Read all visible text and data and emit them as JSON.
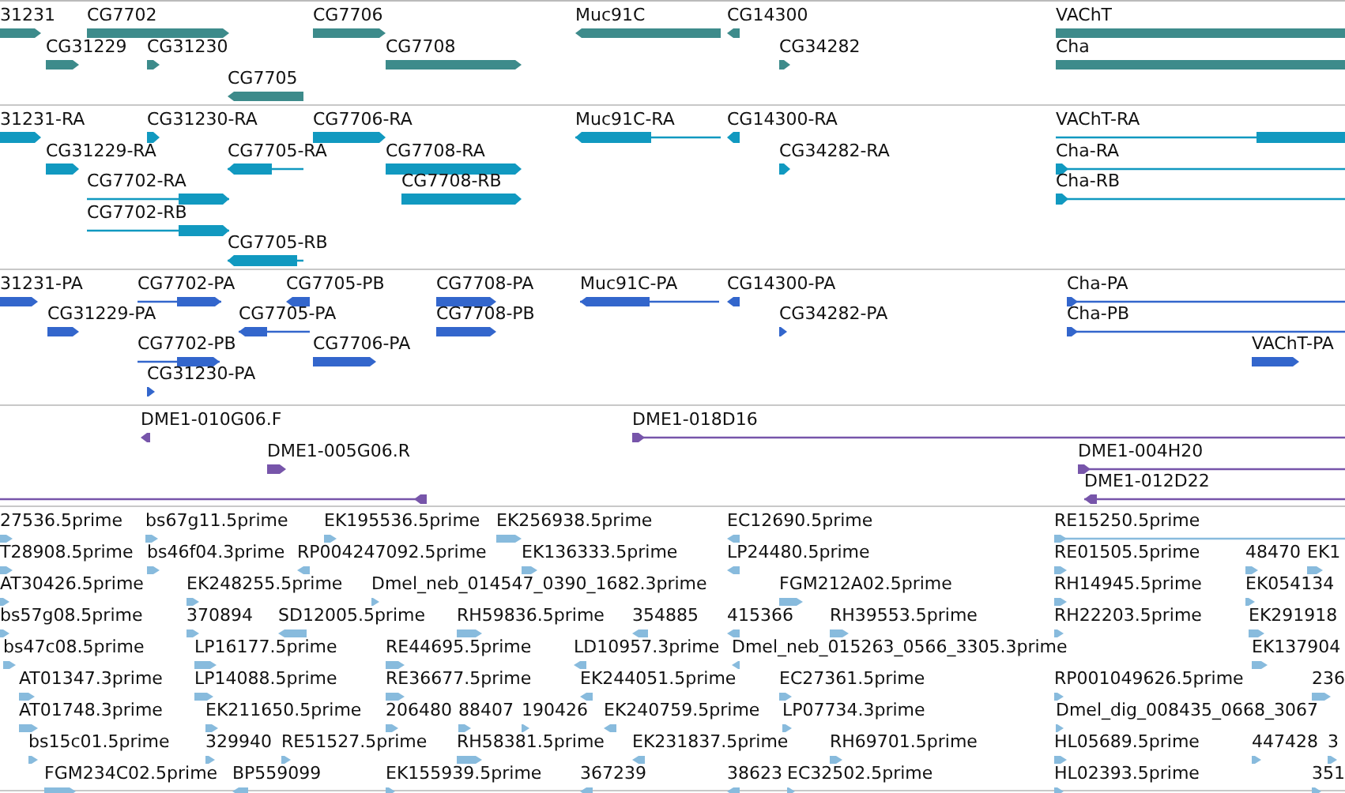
{
  "tracks": [
    {
      "kind": "gene",
      "features": [
        {
          "label": "31231",
          "reverse": false
        },
        {
          "label": "CG7702",
          "reverse": false
        },
        {
          "label": "CG7706",
          "reverse": false
        },
        {
          "label": "Muc91C",
          "reverse": true
        },
        {
          "label": "CG14300",
          "reverse": true
        },
        {
          "label": "VAChT",
          "reverse": false
        },
        {
          "label": "CG31229",
          "reverse": false
        },
        {
          "label": "CG31230",
          "reverse": false
        },
        {
          "label": "CG7708",
          "reverse": false
        },
        {
          "label": "CG34282",
          "reverse": false
        },
        {
          "label": "Cha",
          "reverse": false
        },
        {
          "label": "CG7705",
          "reverse": true
        }
      ]
    },
    {
      "kind": "transcript",
      "features": [
        {
          "label": "31231-RA",
          "reverse": false
        },
        {
          "label": "CG31230-RA",
          "reverse": false
        },
        {
          "label": "CG7706-RA",
          "reverse": false
        },
        {
          "label": "Muc91C-RA",
          "reverse": true
        },
        {
          "label": "CG14300-RA",
          "reverse": true
        },
        {
          "label": "VAChT-RA",
          "reverse": false
        },
        {
          "label": "CG31229-RA",
          "reverse": false
        },
        {
          "label": "CG7705-RA",
          "reverse": true
        },
        {
          "label": "CG7708-RA",
          "reverse": false
        },
        {
          "label": "CG34282-RA",
          "reverse": false
        },
        {
          "label": "Cha-RA",
          "reverse": false
        },
        {
          "label": "CG7702-RA",
          "reverse": false
        },
        {
          "label": "CG7708-RB",
          "reverse": false
        },
        {
          "label": "Cha-RB",
          "reverse": false
        },
        {
          "label": "CG7702-RB",
          "reverse": false
        },
        {
          "label": "CG7705-RB",
          "reverse": true
        }
      ]
    },
    {
      "kind": "protein",
      "features": [
        {
          "label": "31231-PA",
          "reverse": false
        },
        {
          "label": "CG7702-PA",
          "reverse": false
        },
        {
          "label": "CG7705-PB",
          "reverse": true
        },
        {
          "label": "CG7708-PA",
          "reverse": false
        },
        {
          "label": "Muc91C-PA",
          "reverse": true
        },
        {
          "label": "CG14300-PA",
          "reverse": true
        },
        {
          "label": "Cha-PA",
          "reverse": false
        },
        {
          "label": "CG31229-PA",
          "reverse": false
        },
        {
          "label": "CG7705-PA",
          "reverse": true
        },
        {
          "label": "CG7708-PB",
          "reverse": false
        },
        {
          "label": "CG34282-PA",
          "reverse": false
        },
        {
          "label": "Cha-PB",
          "reverse": false
        },
        {
          "label": "CG7702-PB",
          "reverse": false
        },
        {
          "label": "CG7706-PA",
          "reverse": false
        },
        {
          "label": "VAChT-PA",
          "reverse": false
        },
        {
          "label": "CG31230-PA",
          "reverse": false
        }
      ]
    },
    {
      "kind": "clone",
      "features": [
        {
          "label": "DME1-010G06.F",
          "reverse": true
        },
        {
          "label": "DME1-018D16",
          "reverse": false
        },
        {
          "label": "DME1-005G06.R",
          "reverse": false
        },
        {
          "label": "DME1-004H20",
          "reverse": false
        },
        {
          "reverse": true
        },
        {
          "label": "DME1-012D22",
          "reverse": true
        }
      ]
    },
    {
      "kind": "est",
      "features": [
        {
          "label": "27536.5prime",
          "reverse": false
        },
        {
          "label": "bs67g11.5prime",
          "reverse": false
        },
        {
          "label": "EK195536.5prime",
          "reverse": false
        },
        {
          "label": "EK256938.5prime",
          "reverse": false
        },
        {
          "label": "EC12690.5prime",
          "reverse": true
        },
        {
          "label": "RE15250.5prime",
          "reverse": false
        },
        {
          "label": "T28908.5prime",
          "reverse": false
        },
        {
          "label": "bs46f04.3prime",
          "reverse": false
        },
        {
          "label": "RP004247092.5prime",
          "reverse": true
        },
        {
          "label": "EK136333.5prime",
          "reverse": false
        },
        {
          "label": "LP24480.5prime",
          "reverse": true
        },
        {
          "label": "RE01505.5prime",
          "reverse": false
        },
        {
          "label": "48470",
          "reverse": false
        },
        {
          "label": "EK1",
          "reverse": false
        },
        {
          "label": "AT30426.5prime",
          "reverse": false
        },
        {
          "label": "EK248255.5prime",
          "reverse": false
        },
        {
          "label": "Dmel_neb_014547_0390_1682.3prime",
          "reverse": false
        },
        {
          "label": "FGM212A02.5prime",
          "reverse": false
        },
        {
          "label": "RH14945.5prime",
          "reverse": false
        },
        {
          "label": "EK054134",
          "reverse": false
        },
        {
          "label": "bs57g08.5prime",
          "reverse": false
        },
        {
          "label": "370894",
          "reverse": false
        },
        {
          "label": "SD12005.5prime",
          "reverse": true
        },
        {
          "label": "RH59836.5prime",
          "reverse": false
        },
        {
          "label": "354885",
          "reverse": true
        },
        {
          "label": "415366",
          "reverse": true
        },
        {
          "label": "RH39553.5prime",
          "reverse": false
        },
        {
          "label": "RH22203.5prime",
          "reverse": false
        },
        {
          "label": "EK291918",
          "reverse": false
        },
        {
          "label": "bs47c08.5prime",
          "reverse": false
        },
        {
          "label": "LP16177.5prime",
          "reverse": false
        },
        {
          "label": "RE44695.5prime",
          "reverse": false
        },
        {
          "label": "LD10957.3prime",
          "reverse": true
        },
        {
          "label": "Dmel_neb_015263_0566_3305.3prime",
          "reverse": true
        },
        {
          "label": "EK137904",
          "reverse": false
        },
        {
          "label": "AT01347.3prime",
          "reverse": false
        },
        {
          "label": "LP14088.5prime",
          "reverse": false
        },
        {
          "label": "RE36677.5prime",
          "reverse": false
        },
        {
          "label": "EK244051.5prime",
          "reverse": true
        },
        {
          "label": "EC27361.5prime",
          "reverse": false
        },
        {
          "label": "RP001049626.5prime",
          "reverse": false
        },
        {
          "label": "236",
          "reverse": false
        },
        {
          "label": "AT01748.3prime",
          "reverse": false
        },
        {
          "label": "EK211650.5prime",
          "reverse": false
        },
        {
          "label": "206480",
          "reverse": false
        },
        {
          "label": "88407",
          "reverse": false
        },
        {
          "label": "190426",
          "reverse": false
        },
        {
          "label": "EK240759.5prime",
          "reverse": true
        },
        {
          "label": "LP07734.3prime",
          "reverse": false
        },
        {
          "label": "Dmel_dig_008435_0668_3067",
          "reverse": false
        },
        {
          "label": "bs15c01.5prime",
          "reverse": false
        },
        {
          "label": "329940",
          "reverse": false
        },
        {
          "label": "RE51527.5prime",
          "reverse": false
        },
        {
          "label": "RH58381.5prime",
          "reverse": false
        },
        {
          "label": "EK231837.5prime",
          "reverse": true
        },
        {
          "label": "RH69701.5prime",
          "reverse": false
        },
        {
          "label": "HL05689.5prime",
          "reverse": false
        },
        {
          "label": "447428",
          "reverse": false
        },
        {
          "label": "3",
          "reverse": false
        },
        {
          "label": "FGM234C02.5prime",
          "reverse": false
        },
        {
          "label": "BP559099",
          "reverse": true
        },
        {
          "label": "EK155939.5prime",
          "reverse": false
        },
        {
          "label": "367239",
          "reverse": true
        },
        {
          "label": "38623",
          "reverse": true
        },
        {
          "label": "EC32502.5prime",
          "reverse": false
        },
        {
          "label": "HL02393.5prime",
          "reverse": false
        },
        {
          "label": "351",
          "reverse": false
        }
      ]
    }
  ]
}
